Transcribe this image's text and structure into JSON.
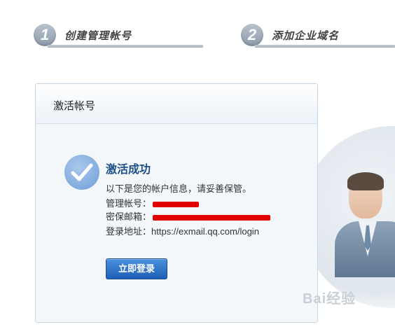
{
  "steps": [
    {
      "number": "1",
      "label": "创建管理帐号"
    },
    {
      "number": "2",
      "label": "添加企业域名"
    }
  ],
  "card": {
    "title": "激活帐号",
    "success_title": "激活成功",
    "note": "以下是您的帐户信息，请妥善保管。",
    "admin_label": "管理帐号：",
    "email_label": "密保邮箱：",
    "login_label": "登录地址：",
    "login_url": "https://exmail.qq.com/login",
    "login_button": "立即登录"
  },
  "watermark": "Bai经验",
  "colors": {
    "accent": "#1e5fb6",
    "title_blue": "#1d4f87",
    "redaction": "#e00000"
  },
  "icons": [
    "check-icon"
  ]
}
